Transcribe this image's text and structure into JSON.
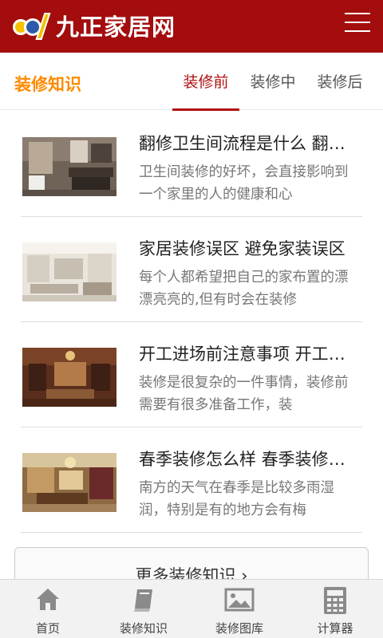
{
  "header": {
    "logo_text": "九正家居网",
    "menu_icon": "hamburger-menu-icon"
  },
  "section": {
    "title": "装修知识",
    "tabs": [
      {
        "label": "装修前",
        "active": true
      },
      {
        "label": "装修中",
        "active": false
      },
      {
        "label": "装修后",
        "active": false
      }
    ]
  },
  "articles": [
    {
      "title": "翻修卫生间流程是什么 翻修卫生间要注意什么",
      "desc": "卫生间装修的好坏，会直接影响到一个家里的人的健康和心"
    },
    {
      "title": "家居装修误区 避免家装误区",
      "desc": "每个人都希望把自己的家布置的漂漂亮亮的,但有时会在装修"
    },
    {
      "title": "开工进场前注意事项 开工前准备",
      "desc": "装修是很复杂的一件事情，装修前需要有很多准备工作，装"
    },
    {
      "title": "春季装修怎么样 春季装修注意事项",
      "desc": "南方的天气在春季是比较多雨湿润，特别是有的地方会有梅"
    }
  ],
  "more_button": {
    "label": "更多装修知识 ›"
  },
  "bottom_nav": [
    {
      "label": "首页",
      "icon": "home-icon"
    },
    {
      "label": "装修知识",
      "icon": "book-icon"
    },
    {
      "label": "装修图库",
      "icon": "image-icon"
    },
    {
      "label": "计算器",
      "icon": "calculator-icon"
    }
  ],
  "colors": {
    "brand": "#a30d0d",
    "accent": "#ff8a00",
    "active_tab": "#b01010"
  }
}
